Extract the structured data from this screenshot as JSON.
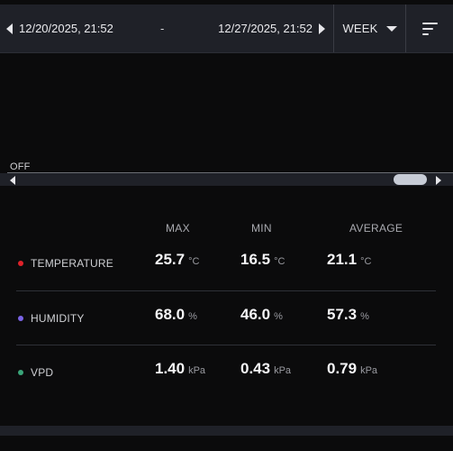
{
  "range": {
    "start": "12/20/2025, 21:52",
    "separator": "-",
    "end": "12/27/2025, 21:52"
  },
  "period": {
    "selected": "WEEK"
  },
  "toggle_label": "OFF",
  "table": {
    "headers": [
      "MAX",
      "MIN",
      "AVERAGE"
    ],
    "rows": [
      {
        "label": "TEMPERATURE",
        "color": "#e0222a",
        "max": "25.7",
        "min": "16.5",
        "avg": "21.1",
        "unit": "°C"
      },
      {
        "label": "HUMIDITY",
        "color": "#7a63e6",
        "max": "68.0",
        "min": "46.0",
        "avg": "57.3",
        "unit": "%"
      },
      {
        "label": "VPD",
        "color": "#3aa57a",
        "max": "1.40",
        "min": "0.43",
        "avg": "0.79",
        "unit": "kPa"
      }
    ]
  },
  "icons": {
    "prev": "triangle-left-icon",
    "next": "triangle-right-icon",
    "dropdown": "chevron-down-icon",
    "sort": "sort-icon"
  }
}
